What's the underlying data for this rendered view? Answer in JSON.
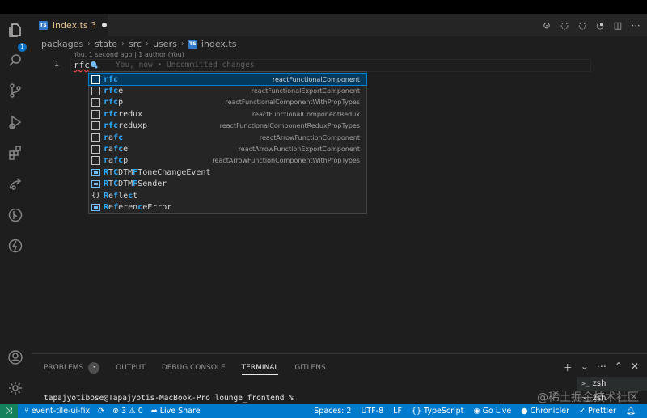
{
  "editor": {
    "tab": {
      "name": "index.ts",
      "modified_count": "3"
    },
    "breadcrumb": [
      "packages",
      "state",
      "src",
      "users",
      "index.ts"
    ],
    "blame_header": "You, 1 second ago | 1 author (You)",
    "line": {
      "number": "1",
      "text": "rfc",
      "inline_blame": "You, now • Uncommitted changes"
    }
  },
  "suggest": {
    "items": [
      {
        "match": "rfc",
        "rest": "",
        "detail": "reactFunctionalComponent",
        "kind": "snippet"
      },
      {
        "match": "rfc",
        "rest": "e",
        "detail": "reactFunctionalExportComponent",
        "kind": "snippet"
      },
      {
        "match": "rfc",
        "rest": "p",
        "detail": "reactFunctionalComponentWithPropTypes",
        "kind": "snippet"
      },
      {
        "match": "rfc",
        "rest": "redux",
        "detail": "reactFunctionalComponentRedux",
        "kind": "snippet"
      },
      {
        "match": "rfc",
        "rest": "reduxp",
        "detail": "reactFunctionalComponentReduxPropTypes",
        "kind": "snippet"
      },
      {
        "pre": "r",
        "match": "afc",
        "rest": "",
        "detail": "reactArrowFunctionComponent",
        "kind": "snippet"
      },
      {
        "pre": "r",
        "match": "afc",
        "rest": "e",
        "detail": "reactArrowFunctionExportComponent",
        "kind": "snippet"
      },
      {
        "pre": "r",
        "match": "afc",
        "rest": "p",
        "detail": "reactArrowFunctionComponentWithPropTypes",
        "kind": "snippet"
      },
      {
        "label": "RTCDTMFToneChangeEvent",
        "detail": "",
        "kind": "class"
      },
      {
        "label": "RTCDTMFSender",
        "detail": "",
        "kind": "class"
      },
      {
        "label": "Reflect",
        "detail": "",
        "kind": "module"
      },
      {
        "label": "ReferenceError",
        "detail": "",
        "kind": "class"
      }
    ]
  },
  "activity_badge": "1",
  "panel": {
    "tabs": [
      "PROBLEMS",
      "OUTPUT",
      "DEBUG CONSOLE",
      "TERMINAL",
      "GITLENS"
    ],
    "problems_count": "3",
    "terminals": [
      "zsh",
      "zsh"
    ],
    "prompt": "tapajyotibose@Tapajyotis-MacBook-Pro lounge_frontend %"
  },
  "statusbar": {
    "branch": "event-tile-ui-fix",
    "errors": "3",
    "warnings": "0",
    "live_share": "Live Share",
    "spaces": "Spaces: 2",
    "encoding": "UTF-8",
    "eol": "LF",
    "language": "TypeScript",
    "go_live": "Go Live",
    "chronicler": "Chronicler",
    "prettier": "Prettier"
  },
  "watermark": "@稀土掘金技术社区",
  "colors": {
    "accent": "#007acc",
    "remote": "#16825d",
    "suggest_highlight": "#2aaaff",
    "modified": "#e2c08d"
  }
}
